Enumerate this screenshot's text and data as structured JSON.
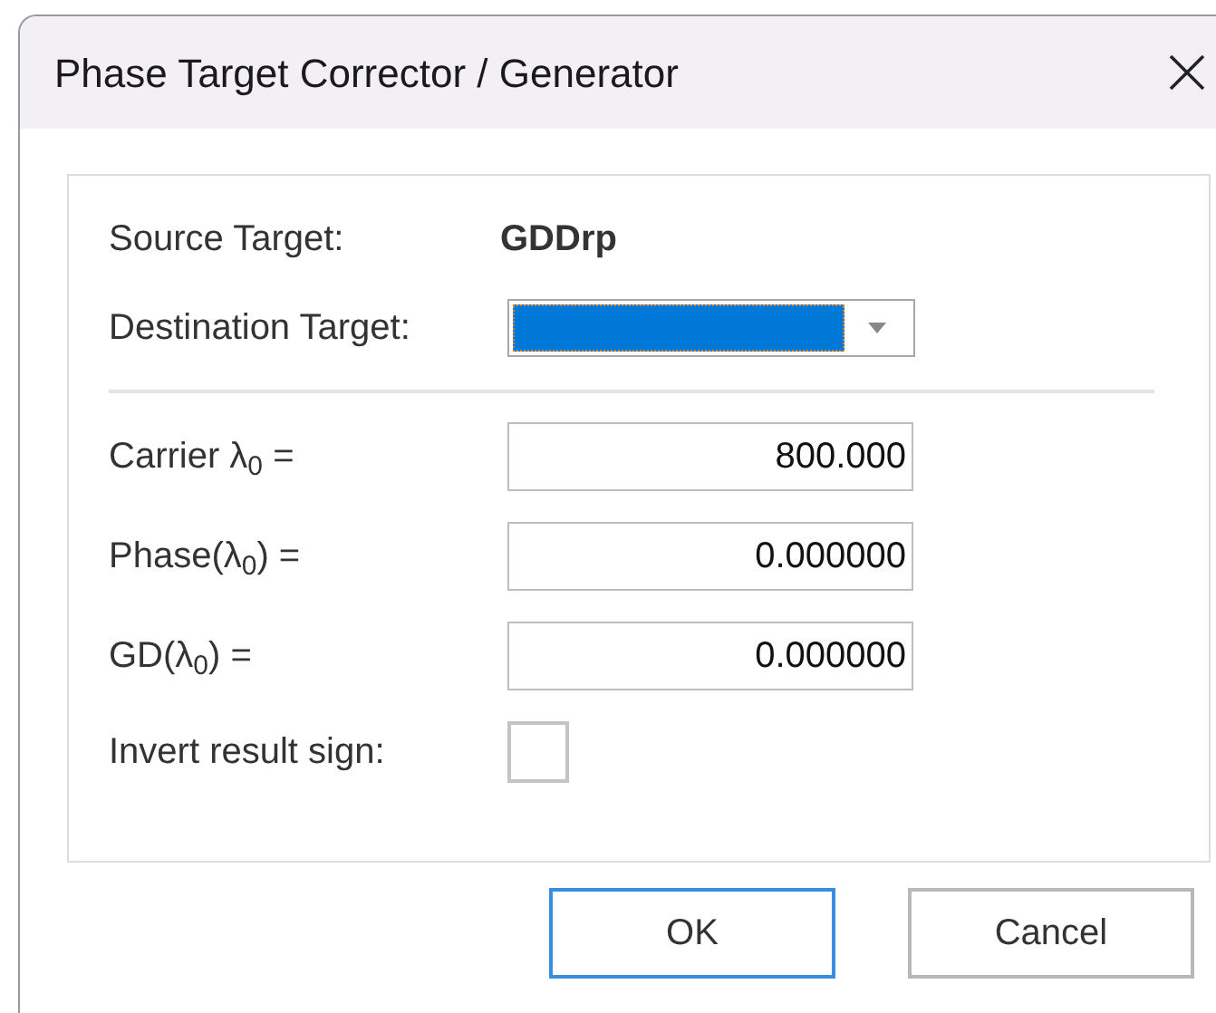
{
  "window": {
    "title": "Phase Target Corrector / Generator"
  },
  "source_target": {
    "label": "Source Target:",
    "value": "GDDrp"
  },
  "destination_target": {
    "label": "Destination Target:",
    "focused": true
  },
  "fields": [
    {
      "label": "Carrier λ$_{0}$ =",
      "value": "800.000"
    },
    {
      "label": "Phase(λ$_{0}$) =",
      "value": "0.000000"
    },
    {
      "label": "GD(λ$_{0}$) =",
      "value": "0.000000"
    }
  ],
  "invert_result_sign": {
    "label": "Invert result sign:",
    "checked": false
  },
  "buttons": [
    {
      "label": "OK",
      "default": true
    },
    {
      "label": "Cancel",
      "default": false
    }
  ]
}
